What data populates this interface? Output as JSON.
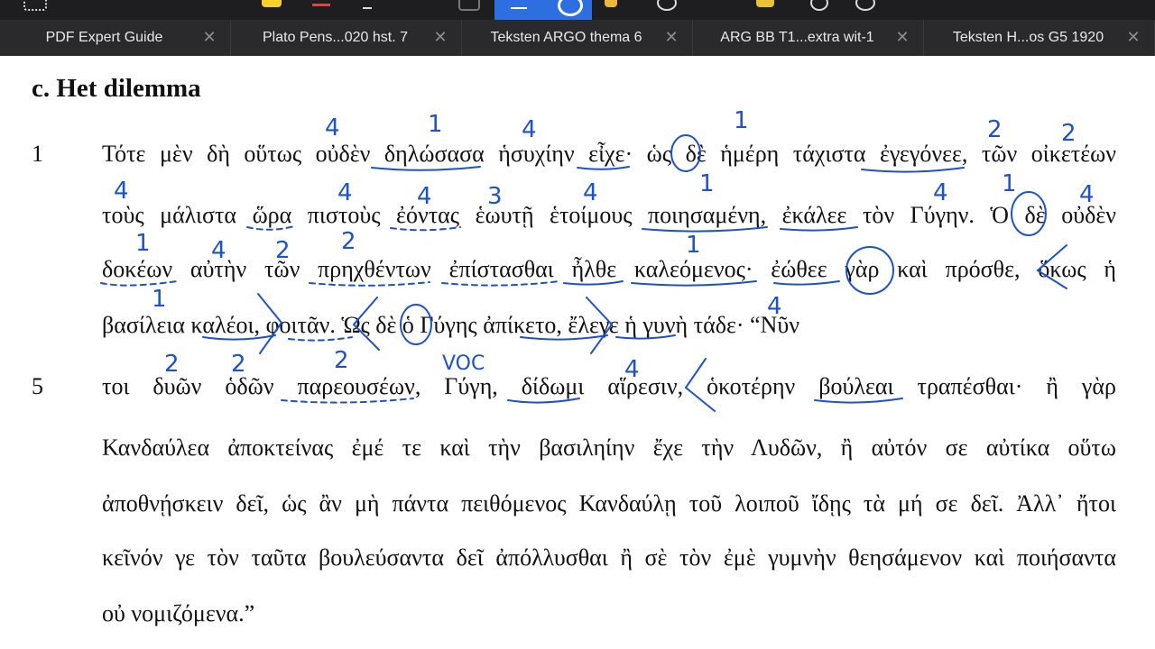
{
  "toolbar": {
    "icons": [
      "grid-icon",
      "highlight-icon",
      "text-color-icon",
      "pen-icon",
      "shape-icon",
      "annotate-icon",
      "select-icon",
      "marker-icon",
      "stamp-icon",
      "comment-icon",
      "search-icon",
      "more-icon"
    ]
  },
  "tabs": [
    {
      "label": "PDF Expert Guide"
    },
    {
      "label": "Plato Pens...020 hst. 7"
    },
    {
      "label": "Teksten ARGO thema 6"
    },
    {
      "label": "ARG BB T1...extra wit-1"
    },
    {
      "label": "Teksten H...os G5 1920"
    }
  ],
  "document": {
    "heading": "c. Het dilemma",
    "line_numbers": [
      "1",
      "5"
    ],
    "lines": [
      "Τότε μὲν δὴ οὕτως οὐδὲν δηλώσασα ἡσυχίην εἶχε· ὡς δὲ ἡμέρη τάχιστα ἐγεγόνεε, τῶν οἰκετέων",
      "τοὺς μάλιστα ὥρα πιστοὺς ἐόντας ἑωυτῇ ἑτοίμους ποιησαμένη, ἐκάλεε τὸν Γύγην. Ὁ δὲ οὐδὲν",
      "δοκέων αὐτὴν τῶν πρηχθέντων ἐπίστασθαι ἦλθε καλεόμενος· ἐώθεε γὰρ καὶ πρόσθε, ὅκως ἡ",
      "βασίλεια καλέοι, φοιτᾶν. Ὡς δὲ ὁ Γύγης ἀπίκετο, ἔλεγε ἡ γυνὴ τάδε· “Νῦν",
      "τοι δυῶν ὁδῶν παρεουσέων, Γύγη, δίδωμι αἵρεσιν, ὁκοτέρην βούλεαι τραπέσθαι· ἢ γὰρ",
      "Κανδαύλεα ἀποκτείνας ἐμέ τε καὶ τὴν βασιληίην ἔχε τὴν Λυδῶν, ἢ αὐτόν σε αὐτίκα οὕτω",
      "ἀποθνῄσκειν δεῖ, ὡς ἂν μὴ πάντα πειθόμενος Κανδαύλῃ τοῦ λοιποῦ ἴδῃς τὰ μή σε δεῖ. Ἀλλ᾽ ἤτοι",
      "κεῖνόν γε τὸν ταῦτα βουλεύσαντα δεῖ ἀπόλλυσθαι ἢ σὲ τὸν ἐμὲ γυμνὴν θεησάμενον καὶ ποιήσαντα",
      "οὐ νομιζόμενα.”"
    ]
  },
  "annotations": {
    "color": "#1d52c8",
    "numbers": [
      "4",
      "1",
      "4",
      "1",
      "2",
      "2",
      "4",
      "4",
      "4",
      "3",
      "4",
      "1",
      "4",
      "1",
      "4",
      "1",
      "4",
      "2",
      "2",
      "1",
      "1",
      "4",
      "2",
      "2",
      "2",
      "4"
    ],
    "labels": [
      "VOC"
    ]
  },
  "colors": {
    "toolbar_bg": "#1e1e20",
    "tabbar_bg": "#2a2a2c",
    "tab_text": "#e8e8ea",
    "accent": "#2d6fe0",
    "ink": "#1d52c8"
  }
}
